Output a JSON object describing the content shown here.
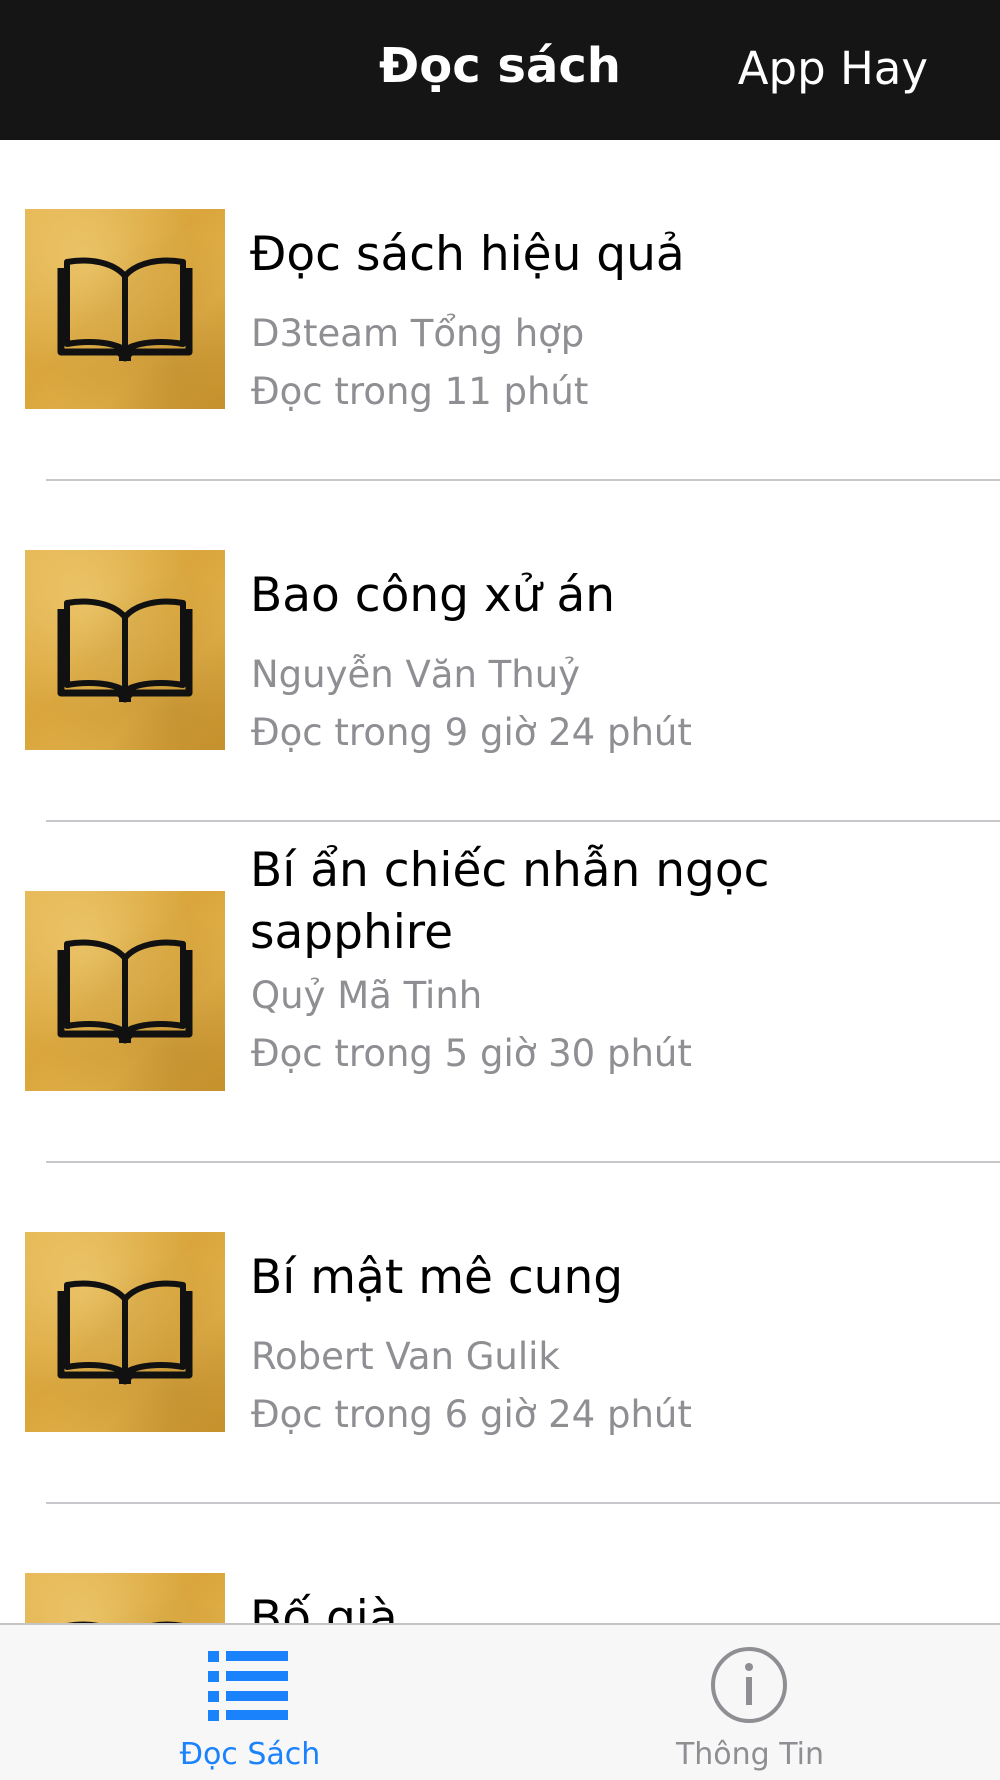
{
  "navbar": {
    "title": "Đọc sách",
    "right_button": "App Hay"
  },
  "books": [
    {
      "title": "Đọc sách hiệu quả",
      "author": "D3team Tổng hợp",
      "reading_time": "Đọc trong 11 phút",
      "icon": "open-book-icon"
    },
    {
      "title": "Bao công xử án",
      "author": "Nguyễn Văn Thuỷ",
      "reading_time": "Đọc trong 9 giờ 24 phút",
      "icon": "open-book-icon"
    },
    {
      "title": "Bí ẩn chiếc nhẫn ngọc sapphire",
      "author": "Quỷ Mã Tinh",
      "reading_time": "Đọc trong 5 giờ 30 phút",
      "icon": "open-book-icon"
    },
    {
      "title": "Bí mật mê cung",
      "author": "Robert Van Gulik",
      "reading_time": "Đọc trong 6 giờ 24 phút",
      "icon": "open-book-icon"
    },
    {
      "title": "Bố già",
      "icon": "open-book-icon"
    }
  ],
  "tabbar": {
    "tabs": [
      {
        "label": "Đọc Sách",
        "icon": "list-icon",
        "selected": true
      },
      {
        "label": "Thông Tin",
        "icon": "info-icon",
        "selected": false
      }
    ]
  },
  "colors": {
    "navbar_bg": "#151515",
    "accent": "#1a82fb",
    "secondary_text": "#8e8e93",
    "thumbnail_gold": "#dcaa43"
  }
}
